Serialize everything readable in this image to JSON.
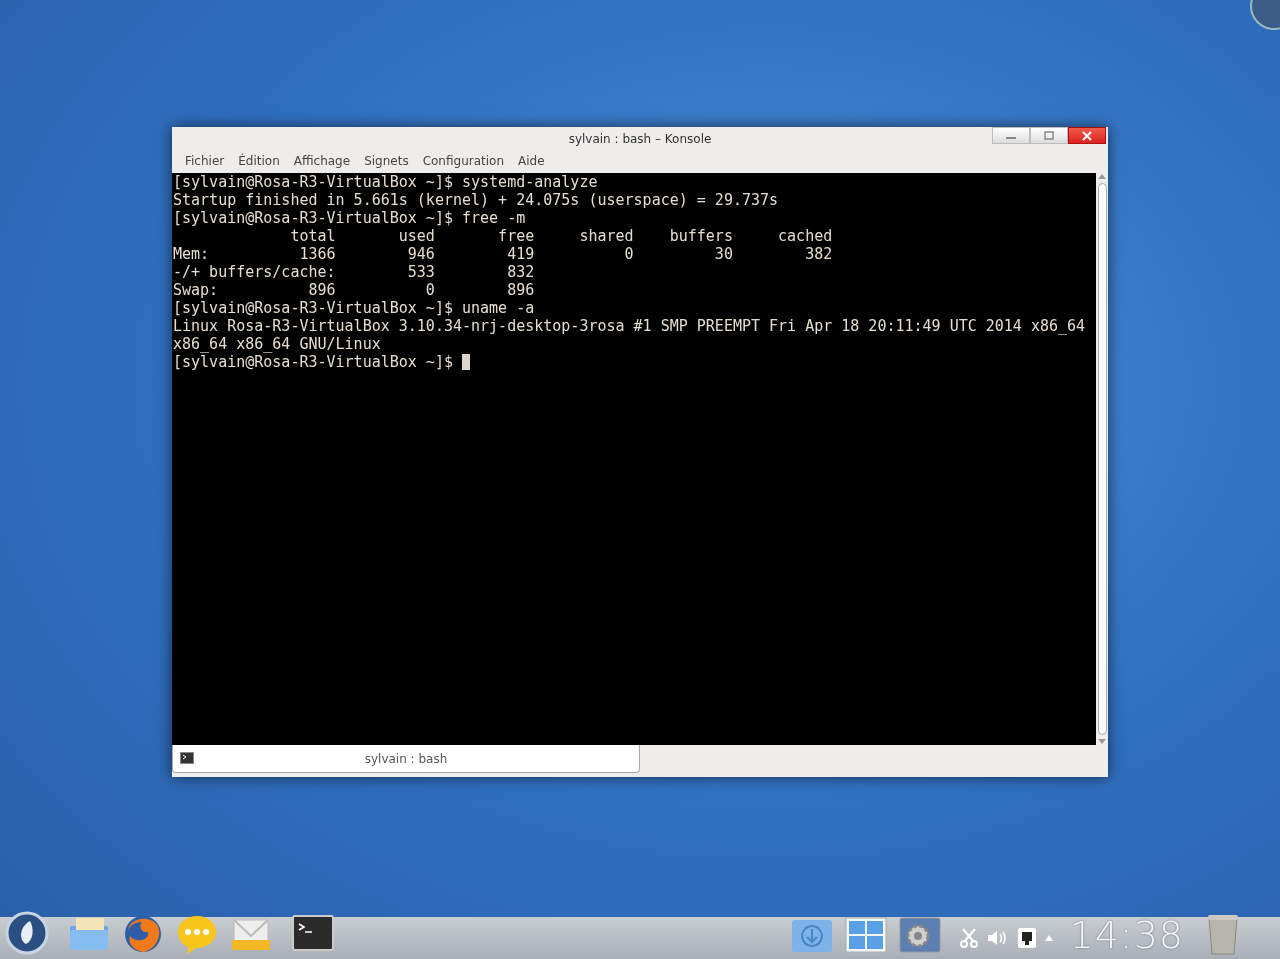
{
  "window": {
    "title": "sylvain : bash – Konsole"
  },
  "menu": [
    "Fichier",
    "Édition",
    "Affichage",
    "Signets",
    "Configuration",
    "Aide"
  ],
  "terminal": {
    "lines": [
      "[sylvain@Rosa-R3-VirtualBox ~]$ systemd-analyze",
      "Startup finished in 5.661s (kernel) + 24.075s (userspace) = 29.737s",
      "[sylvain@Rosa-R3-VirtualBox ~]$ free -m",
      "             total       used       free     shared    buffers     cached",
      "Mem:          1366        946        419          0         30        382",
      "-/+ buffers/cache:        533        832",
      "Swap:          896          0        896",
      "[sylvain@Rosa-R3-VirtualBox ~]$ uname -a",
      "Linux Rosa-R3-VirtualBox 3.10.34-nrj-desktop-3rosa #1 SMP PREEMPT Fri Apr 18 20:11:49 UTC 2014 x86_64",
      "x86_64 x86_64 GNU/Linux",
      "[sylvain@Rosa-R3-VirtualBox ~]$ "
    ]
  },
  "tabs": [
    {
      "label": "sylvain : bash",
      "selected": true
    }
  ],
  "taskbar": {
    "clock": "14:38"
  }
}
